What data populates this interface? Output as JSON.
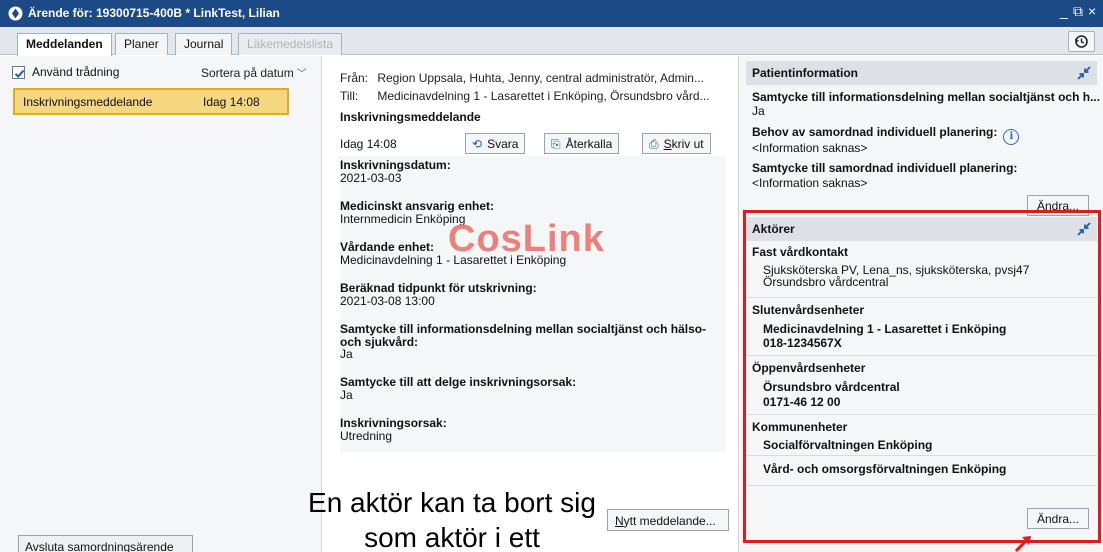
{
  "window": {
    "title": "Ärende för: 19300715-400B * LinkTest, Lilian",
    "controls": [
      "_",
      "⧉",
      "×"
    ]
  },
  "tabs": [
    {
      "label": "Meddelanden",
      "active": true
    },
    {
      "label": "Planer",
      "active": false
    },
    {
      "label": "Journal",
      "active": false
    },
    {
      "label": "Läkemedelslista",
      "disabled": true
    }
  ],
  "left": {
    "use_threading_label": "Använd trådning",
    "use_threading_checked": true,
    "sort_label": "Sortera på datum",
    "messages": [
      {
        "subject": "Inskrivningsmeddelande",
        "time": "Idag 14:08"
      }
    ],
    "end_case_button": {
      "prefix": "A",
      "rest": "vsluta samordningsärende"
    }
  },
  "message": {
    "from_label": "Från:",
    "from_value": "Region Uppsala, Huhta, Jenny, central administratör, Admin...",
    "to_label": "Till:",
    "to_value": "Medicinavdelning 1 - Lasarettet i Enköping, Örsundsbro vård...",
    "subject": "Inskrivningsmeddelande",
    "date": "Idag 14:08",
    "reply_label": "Svara",
    "recall_label": "Återkalla",
    "print_prefix": "S",
    "print_rest": "kriv ut",
    "watermark": "CosLink",
    "fields": [
      {
        "label": "Inskrivningsdatum:",
        "value": "2021-03-03"
      },
      {
        "label": "Medicinskt ansvarig enhet:",
        "value": "Internmedicin Enköping"
      },
      {
        "label": "Vårdande enhet:",
        "value": "Medicinavdelning 1 - Lasarettet i Enköping"
      },
      {
        "label": "Beräknad tidpunkt för utskrivning:",
        "value": "2021-03-08  13:00"
      },
      {
        "label": "Samtycke till informationsdelning mellan socialtjänst och hälso-",
        "label2": "och sjukvård:",
        "value": "Ja"
      },
      {
        "label": "Samtycke till att delge inskrivningsorsak:",
        "value": "Ja"
      },
      {
        "label": "Inskrivningsorsak:",
        "value": "Utredning"
      }
    ],
    "new_message_button": {
      "prefix": "N",
      "rest": "ytt meddelande..."
    }
  },
  "patient_info": {
    "header": "Patientinformation",
    "consent_label": "Samtycke till informationsdelning mellan socialtjänst och h...",
    "consent_value": "Ja",
    "need_plan_label": "Behov av samordnad individuell planering:",
    "need_plan_value": "<Information saknas>",
    "consent_plan_label": "Samtycke till samordnad individuell planering:",
    "consent_plan_value": "<Information saknas>",
    "edit_button": "Ändra..."
  },
  "actors": {
    "header": "Aktörer",
    "groups": [
      {
        "title": "Fast vårdkontakt",
        "lines": [
          "Sjuksköterska PV, Lena_ns, sjuksköterska, pvsj47",
          "Örsundsbro vårdcentral"
        ],
        "bold": false
      },
      {
        "title": "Slutenvårdsenheter",
        "lines": [
          "Medicinavdelning 1 - Lasarettet i Enköping",
          "018-1234567X"
        ],
        "bold": true
      },
      {
        "title": "Öppenvårdsenheter",
        "lines": [
          "Örsundsbro vårdcentral",
          "0171-46 12 00"
        ],
        "bold": true
      },
      {
        "title": "Kommunenheter",
        "lines": [
          "Socialförvaltningen Enköping"
        ],
        "bold": true
      },
      {
        "title": "",
        "lines": [
          "Vård- och omsorgsförvaltningen Enköping"
        ],
        "bold": true
      }
    ],
    "edit_button": "Ändra..."
  },
  "annotation": {
    "line1": "En aktör kan ta bort sig",
    "line2": "som aktör i ett"
  },
  "colors": {
    "titlebar": "#1b4a86",
    "selected_item_fill": "#f5d780",
    "selected_item_border": "#e3a91f",
    "highlight_box": "#e01b1b",
    "watermark": "#e76157"
  }
}
